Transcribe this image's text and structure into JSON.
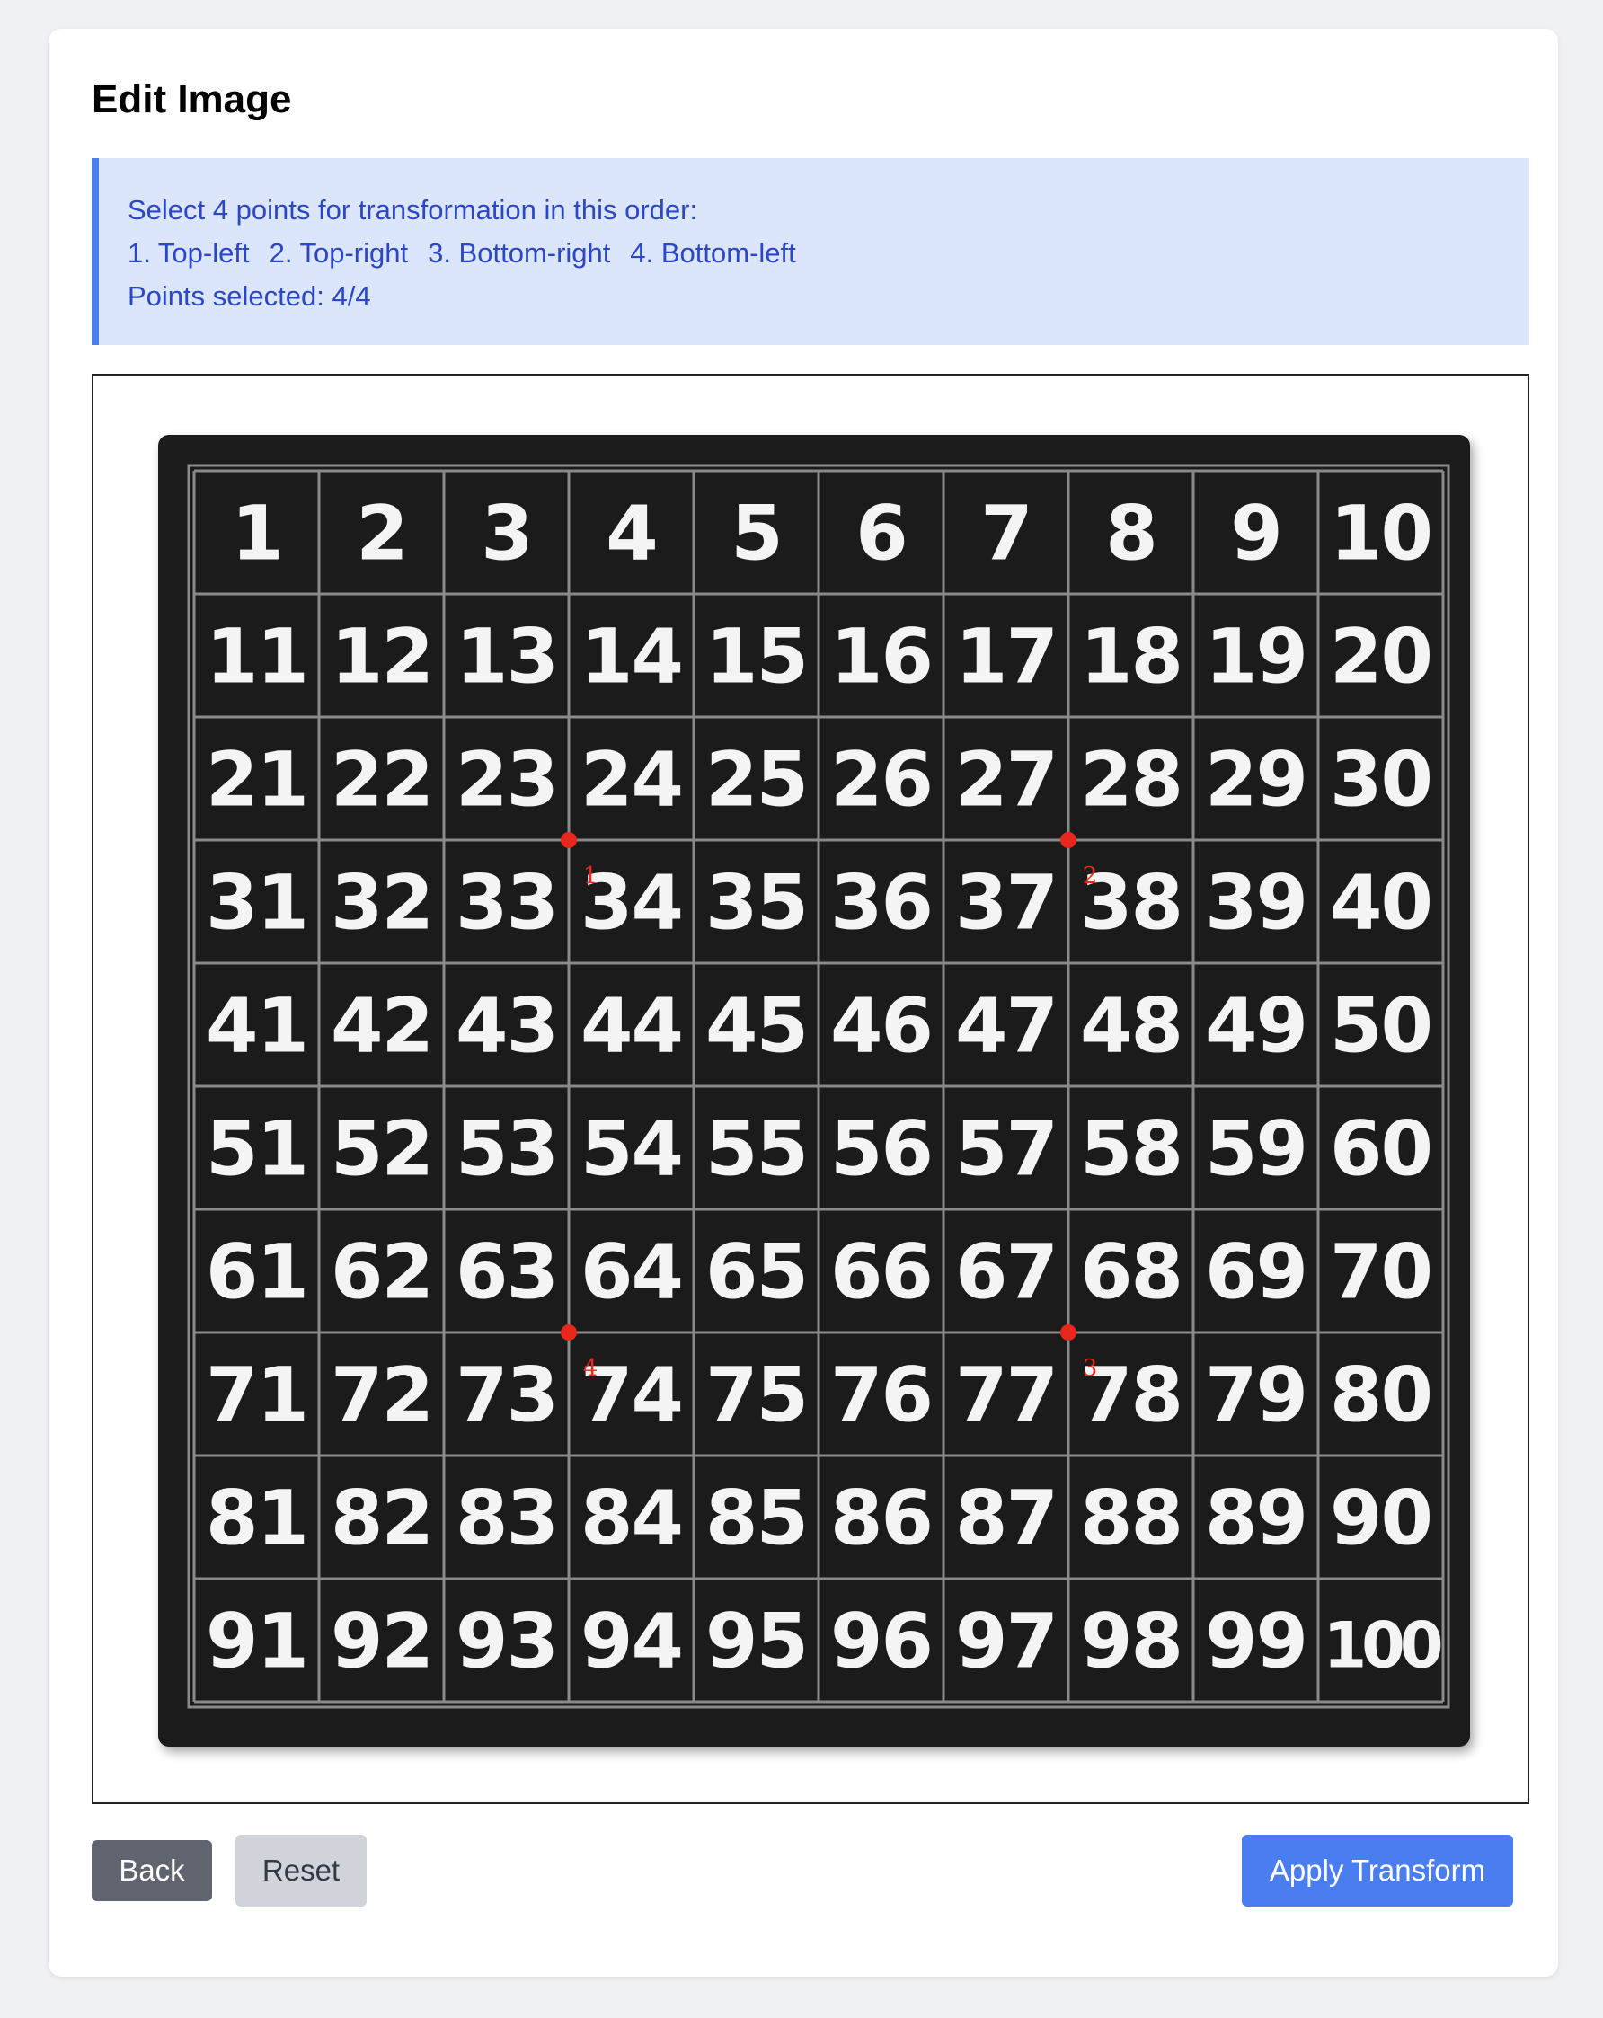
{
  "page": {
    "title": "Edit Image"
  },
  "instructions": {
    "line1": "Select 4 points for transformation in this order:",
    "steps": [
      "1. Top-left",
      "2. Top-right",
      "3. Bottom-right",
      "4. Bottom-left"
    ],
    "status_label": "Points selected:",
    "status_value": "4/4",
    "colors": {
      "background": "#dbe5fb",
      "accent": "#4a7ee8",
      "text": "#2b47c6"
    }
  },
  "image": {
    "description_kind": "number grid 1-100",
    "rows": 10,
    "cols": 10,
    "numbers": [
      "1",
      "2",
      "3",
      "4",
      "5",
      "6",
      "7",
      "8",
      "9",
      "10",
      "11",
      "12",
      "13",
      "14",
      "15",
      "16",
      "17",
      "18",
      "19",
      "20",
      "21",
      "22",
      "23",
      "24",
      "25",
      "26",
      "27",
      "28",
      "29",
      "30",
      "31",
      "32",
      "33",
      "34",
      "35",
      "36",
      "37",
      "38",
      "39",
      "40",
      "41",
      "42",
      "43",
      "44",
      "45",
      "46",
      "47",
      "48",
      "49",
      "50",
      "51",
      "52",
      "53",
      "54",
      "55",
      "56",
      "57",
      "58",
      "59",
      "60",
      "61",
      "62",
      "63",
      "64",
      "65",
      "66",
      "67",
      "68",
      "69",
      "70",
      "71",
      "72",
      "73",
      "74",
      "75",
      "76",
      "77",
      "78",
      "79",
      "80",
      "81",
      "82",
      "83",
      "84",
      "85",
      "86",
      "87",
      "88",
      "89",
      "90",
      "91",
      "92",
      "93",
      "94",
      "95",
      "96",
      "97",
      "98",
      "99",
      "100"
    ],
    "board_color": "#1b1b1b",
    "grid_line_color": "#8a8a8a",
    "number_color": "#f4f4f4"
  },
  "selected_points": [
    {
      "label": "1",
      "grid_col": 3,
      "grid_row": 3
    },
    {
      "label": "2",
      "grid_col": 7,
      "grid_row": 3
    },
    {
      "label": "3",
      "grid_col": 7,
      "grid_row": 7
    },
    {
      "label": "4",
      "grid_col": 3,
      "grid_row": 7
    }
  ],
  "point_color": "#e8281c",
  "buttons": {
    "back": "Back",
    "reset": "Reset",
    "apply": "Apply Transform"
  }
}
